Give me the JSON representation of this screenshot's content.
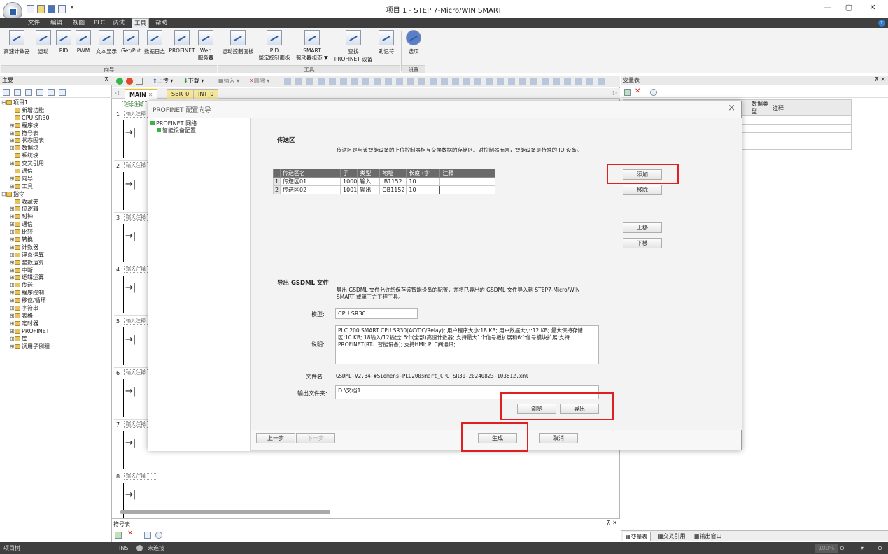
{
  "window": {
    "title": "项目 1 - STEP 7-Micro/WIN SMART",
    "controls": {
      "min": "—",
      "restore": "▢",
      "close": "✕"
    }
  },
  "menu": {
    "items": [
      "文件",
      "编辑",
      "视图",
      "PLC",
      "调试",
      "工具",
      "帮助"
    ],
    "active": "工具"
  },
  "ribbon": {
    "buttons": [
      {
        "label": "高速计数器"
      },
      {
        "label": "运动"
      },
      {
        "label": "PID"
      },
      {
        "label": "PWM"
      },
      {
        "label": "文本显示"
      },
      {
        "label": "Get/Put"
      },
      {
        "label": "数据日志"
      },
      {
        "label": "PROFINET"
      },
      {
        "label": "Web",
        "label2": "服务器"
      },
      {
        "label": "运动控制面板"
      },
      {
        "label": "PID",
        "label2": "整定控制面板"
      },
      {
        "label": "SMART",
        "label2": "驱动器组态 ▼"
      },
      {
        "label": "查找",
        "label2": "PROFINET 设备"
      },
      {
        "label": "助记符"
      },
      {
        "label": "选项"
      }
    ],
    "groups": [
      "向导",
      "工具",
      "设置"
    ]
  },
  "left_panel": {
    "title": "主要",
    "tree": [
      {
        "indent": 0,
        "exp": "⊟",
        "label": "项目1"
      },
      {
        "indent": 1,
        "exp": "",
        "label": "新增功能"
      },
      {
        "indent": 1,
        "exp": "",
        "label": "CPU SR30"
      },
      {
        "indent": 1,
        "exp": "⊞",
        "label": "程序块"
      },
      {
        "indent": 1,
        "exp": "⊞",
        "label": "符号表"
      },
      {
        "indent": 1,
        "exp": "⊞",
        "label": "状态图表"
      },
      {
        "indent": 1,
        "exp": "⊞",
        "label": "数据块"
      },
      {
        "indent": 1,
        "exp": "",
        "label": "系统块"
      },
      {
        "indent": 1,
        "exp": "⊞",
        "label": "交叉引用"
      },
      {
        "indent": 1,
        "exp": "",
        "label": "通信"
      },
      {
        "indent": 1,
        "exp": "⊞",
        "label": "向导"
      },
      {
        "indent": 1,
        "exp": "⊞",
        "label": "工具"
      },
      {
        "indent": 0,
        "exp": "⊟",
        "label": "指令"
      },
      {
        "indent": 1,
        "exp": "",
        "label": "收藏夹"
      },
      {
        "indent": 1,
        "exp": "⊞",
        "label": "位逻辑"
      },
      {
        "indent": 1,
        "exp": "⊞",
        "label": "时钟"
      },
      {
        "indent": 1,
        "exp": "⊞",
        "label": "通信"
      },
      {
        "indent": 1,
        "exp": "⊞",
        "label": "比较"
      },
      {
        "indent": 1,
        "exp": "⊞",
        "label": "转换"
      },
      {
        "indent": 1,
        "exp": "⊞",
        "label": "计数器"
      },
      {
        "indent": 1,
        "exp": "⊞",
        "label": "浮点运算"
      },
      {
        "indent": 1,
        "exp": "⊞",
        "label": "整数运算"
      },
      {
        "indent": 1,
        "exp": "⊞",
        "label": "中断"
      },
      {
        "indent": 1,
        "exp": "⊞",
        "label": "逻辑运算"
      },
      {
        "indent": 1,
        "exp": "⊞",
        "label": "传送"
      },
      {
        "indent": 1,
        "exp": "⊞",
        "label": "程序控制"
      },
      {
        "indent": 1,
        "exp": "⊞",
        "label": "移位/循环"
      },
      {
        "indent": 1,
        "exp": "⊞",
        "label": "字符串"
      },
      {
        "indent": 1,
        "exp": "⊞",
        "label": "表格"
      },
      {
        "indent": 1,
        "exp": "⊞",
        "label": "定时器"
      },
      {
        "indent": 1,
        "exp": "⊞",
        "label": "PROFINET"
      },
      {
        "indent": 1,
        "exp": "⊞",
        "label": "库"
      },
      {
        "indent": 1,
        "exp": "⊞",
        "label": "调用子例程"
      }
    ]
  },
  "editor": {
    "toolbar": {
      "upload": "上传",
      "download": "下载",
      "insert": "插入",
      "delete": "删除"
    },
    "tabs": [
      {
        "label": "MAIN",
        "active": true
      },
      {
        "label": "SBR_0"
      },
      {
        "label": "INT_0"
      }
    ],
    "network_comment_first": "程序注释",
    "network_comment": "输入注释",
    "networks": [
      "1",
      "2",
      "3",
      "4",
      "5",
      "6",
      "7",
      "8"
    ]
  },
  "right_panel": {
    "title": "变量表",
    "columns": [
      "",
      "",
      "数据类型",
      "注释"
    ],
    "tabs": [
      "变量表",
      "交叉引用",
      "输出窗口"
    ]
  },
  "symbol_panel": {
    "title": "符号表"
  },
  "status": {
    "left": "项目树",
    "mode": "INS",
    "conn": "未连接",
    "zoom": "100%"
  },
  "dialog": {
    "title": "PROFINET 配置向导",
    "close": "×",
    "tree": [
      {
        "label": "PROFINET 网络"
      },
      {
        "label": "智能设备配置"
      }
    ],
    "transfer": {
      "heading": "传送区",
      "desc": "传送区是与该智能设备的上位控制器相互交换数据的存储区。对控制器而言，智能设备是特殊的 IO 设备。",
      "columns": [
        "",
        "传送区名",
        "子",
        "类型",
        "地址",
        "长度 (字",
        "注释"
      ],
      "rows": [
        {
          "n": "1",
          "name": "传送区01",
          "sub": "1000",
          "type": "输入",
          "addr": "IB1152",
          "len": "10",
          "cmt": ""
        },
        {
          "n": "2",
          "name": "传送区02",
          "sub": "1001",
          "type": "输出",
          "addr": "QB1152",
          "len": "10",
          "cmt": ""
        }
      ],
      "add": "添加",
      "remove": "移除",
      "up": "上移",
      "down": "下移"
    },
    "export": {
      "heading": "导出 GSDML 文件",
      "desc": "导出 GSDML 文件允许您保存该智能设备的配置，并将已导出的 GSDML 文件导入到 STEP7-Micro/WIN SMART 或第三方工程工具。",
      "model_label": "模型:",
      "model_value": "CPU SR30",
      "desc_label": "说明:",
      "desc_value": "PLC 200 SMART CPU SR30(AC/DC/Relay); 用户程序大小:18 KB; 用户数据大小:12 KB; 最大保持存储区:10 KB; 18输入/12输出; 6个(全部)高速计数器; 支持最大1个信号板扩展和6个信号模块扩展;支持PROFINET(RT、智能设备); 支持HMI; PLC间通讯;",
      "filename_label": "文件名:",
      "filename_value": "GSDML-V2.34-#Siemens-PLC200smart_CPU SR30-20240823-103812.xml",
      "outdir_label": "输出文件夹:",
      "outdir_value": "D:\\文档1",
      "browse": "浏览",
      "export": "导出"
    },
    "footer": {
      "prev": "上一步",
      "next": "下一步",
      "generate": "生成",
      "cancel": "取消"
    }
  }
}
